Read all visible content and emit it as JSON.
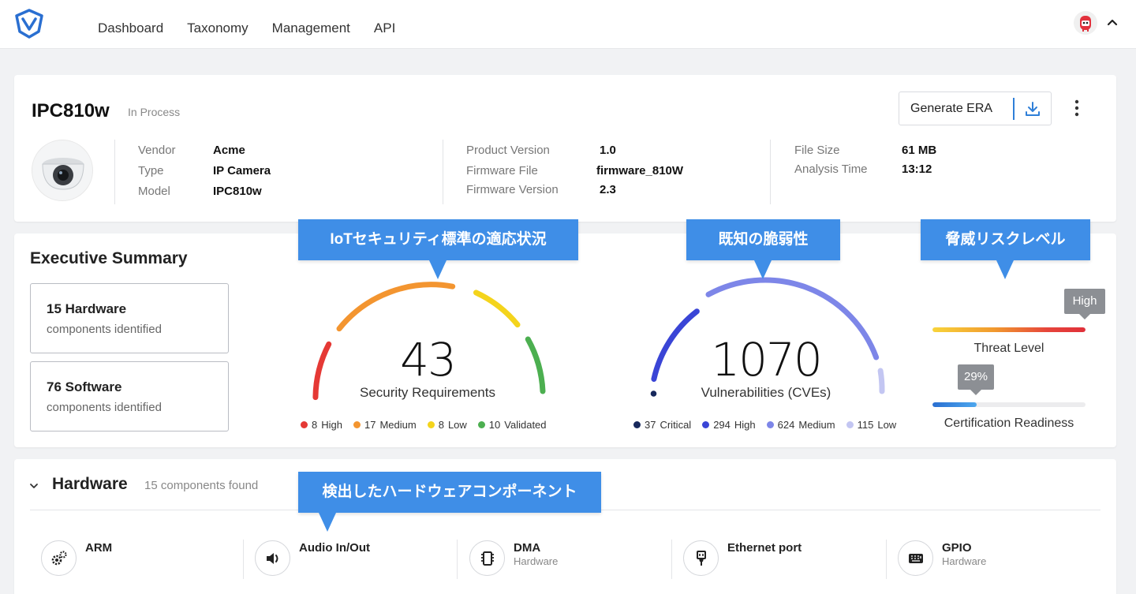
{
  "nav": {
    "items": [
      "Dashboard",
      "Taxonomy",
      "Management",
      "API"
    ]
  },
  "product": {
    "name": "IPC810w",
    "status": "In Process",
    "fields_col1": [
      {
        "k": "Vendor",
        "v": "Acme"
      },
      {
        "k": "Type",
        "v": "IP Camera"
      },
      {
        "k": "Model",
        "v": "IPC810w"
      }
    ],
    "fields_col2": [
      {
        "k": "Product Version",
        "v": "1.0"
      },
      {
        "k": "Firmware File",
        "v": "firmware_810W"
      },
      {
        "k": "Firmware Version",
        "v": "2.3"
      }
    ],
    "fields_col3": [
      {
        "k": "File Size",
        "v": "61 MB"
      },
      {
        "k": "Analysis Time",
        "v": "13:12"
      }
    ],
    "generate_label": "Generate ERA"
  },
  "summary": {
    "title": "Executive Summary",
    "hardware_box": {
      "count": "15 Hardware",
      "desc": "components identified"
    },
    "software_box": {
      "count": "76 Software",
      "desc": "components identified"
    },
    "security": {
      "value": "43",
      "label": "Security Requirements",
      "legend": [
        {
          "n": "8",
          "t": "High",
          "color": "#e53935"
        },
        {
          "n": "17",
          "t": "Medium",
          "color": "#f39530"
        },
        {
          "n": "8",
          "t": "Low",
          "color": "#f4d41c"
        },
        {
          "n": "10",
          "t": "Validated",
          "color": "#4caf50"
        }
      ]
    },
    "vulns": {
      "value": "1070",
      "label": "Vulnerabilities (CVEs)",
      "legend": [
        {
          "n": "37",
          "t": "Critical",
          "color": "#17285c"
        },
        {
          "n": "294",
          "t": "High",
          "color": "#3a45d6"
        },
        {
          "n": "624",
          "t": "Medium",
          "color": "#7d86e8"
        },
        {
          "n": "115",
          "t": "Low",
          "color": "#c3c6f2"
        }
      ]
    },
    "threat": {
      "tip": "High",
      "label": "Threat Level",
      "level": 1.0
    },
    "cert": {
      "tip": "29%",
      "label": "Certification Readiness",
      "level": 0.29
    }
  },
  "hardware": {
    "title": "Hardware",
    "subtitle": "15 components found",
    "items": [
      {
        "name": "ARM",
        "type": ""
      },
      {
        "name": "Audio In/Out",
        "type": ""
      },
      {
        "name": "DMA",
        "type": "Hardware"
      },
      {
        "name": "Ethernet port",
        "type": ""
      },
      {
        "name": "GPIO",
        "type": "Hardware"
      }
    ]
  },
  "callouts": {
    "iot": "IoTセキュリティ標準の適応状況",
    "known": "既知の脆弱性",
    "threat": "脅威リスクレベル",
    "hw": "検出したハードウェアコンポーネント"
  }
}
